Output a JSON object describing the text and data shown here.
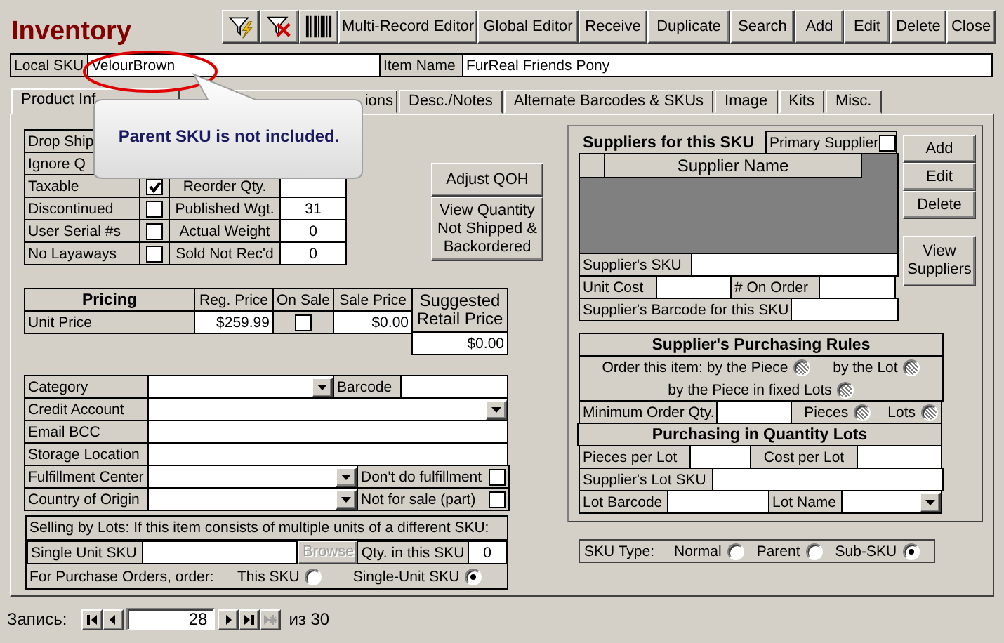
{
  "title": "Inventory",
  "toolbar": [
    {
      "kind": "filter"
    },
    {
      "kind": "unfilter"
    },
    {
      "kind": "barcode"
    },
    {
      "kind": "text",
      "label": "Multi-Record Editor"
    },
    {
      "kind": "text",
      "label": "Global Editor"
    },
    {
      "kind": "text",
      "label": "Receive"
    },
    {
      "kind": "text",
      "label": "Duplicate"
    },
    {
      "kind": "text",
      "label": "Search"
    },
    {
      "kind": "text",
      "label": "Add"
    },
    {
      "kind": "text",
      "label": "Edit"
    },
    {
      "kind": "text",
      "label": "Delete"
    },
    {
      "kind": "text",
      "label": "Close"
    }
  ],
  "sku_bar": {
    "local_sku_label": "Local SKU",
    "local_sku": "VelourBrown",
    "item_name_label": "Item Name",
    "item_name": "FurReal Friends Pony"
  },
  "tabs": [
    {
      "label": "Product Inf",
      "selected": true
    },
    {
      "label": "ions",
      "selected": false
    },
    {
      "label": "Desc./Notes",
      "selected": false
    },
    {
      "label": "Alternate Barcodes & SKUs",
      "selected": false
    },
    {
      "label": "Image",
      "selected": false
    },
    {
      "label": "Kits",
      "selected": false
    },
    {
      "label": "Misc.",
      "selected": false
    }
  ],
  "callout": {
    "text": "Parent SKU is not included."
  },
  "flags": [
    {
      "label": "Drop Ship"
    },
    {
      "label": "Ignore Q"
    },
    {
      "label": "Taxable",
      "checked": true,
      "field_label": "Reorder Qty."
    },
    {
      "label": "Discontinued",
      "checked": false,
      "field_label": "Published Wgt.",
      "field_value": "31"
    },
    {
      "label": "User Serial #s",
      "checked": false,
      "field_label": "Actual Weight",
      "field_value": "0"
    },
    {
      "label": "No Layaways",
      "checked": false,
      "field_label": "Sold Not Rec'd",
      "field_value": "0"
    }
  ],
  "side_buttons": [
    "Adjust QOH",
    "View Quantity Not Shipped & Backordered"
  ],
  "pricing": {
    "header": "Pricing",
    "reg_label": "Reg. Price",
    "on_sale_label": "On Sale",
    "sale_label": "Sale Price",
    "suggested_label": "Suggested Retail Price",
    "row_label": "Unit Price",
    "reg_price": "$259.99",
    "on_sale": false,
    "sale_price": "$0.00",
    "suggested": "$0.00"
  },
  "details": [
    {
      "kind": "combo_pair",
      "label": "Category",
      "label2": "Barcode"
    },
    {
      "kind": "combo",
      "label": "Credit Account"
    },
    {
      "kind": "text",
      "label": "Email BCC"
    },
    {
      "kind": "text",
      "label": "Storage Location"
    },
    {
      "kind": "combo_check",
      "label": "Fulfillment Center",
      "check_label": "Don't do fulfillment",
      "checked": false
    },
    {
      "kind": "combo_check",
      "label": "Country of Origin",
      "check_label": "Not for sale (part)",
      "checked": false
    }
  ],
  "lots": {
    "heading": "Selling by Lots: If this item consists of multiple units of a different SKU:",
    "single_unit_label": "Single Unit SKU",
    "browse": "Browse",
    "browse_disabled": true,
    "qty_label": "Qty. in this SKU",
    "qty": "0",
    "order_label": "For Purchase Orders, order:",
    "options": [
      {
        "label": "This SKU",
        "selected": false
      },
      {
        "label": "Single-Unit SKU",
        "selected": true
      }
    ]
  },
  "suppliers": {
    "title": "Suppliers for this SKU",
    "primary_label": "Primary Supplier",
    "primary": false,
    "column": "Supplier Name",
    "sku_label": "Supplier's SKU",
    "unit_cost_label": "Unit Cost",
    "on_order_label": "# On Order",
    "barcode_label": "Supplier's Barcode for this SKU",
    "buttons": [
      "Add",
      "Edit",
      "Delete"
    ],
    "view_button": "View Suppliers"
  },
  "rules": {
    "title": "Supplier's Purchasing Rules",
    "order_label": "Order this item:",
    "order_options": [
      {
        "label": "by the Piece",
        "indeterminate": true
      },
      {
        "label": "by the Lot",
        "indeterminate": true
      },
      {
        "label": "by the Piece in fixed Lots",
        "indeterminate": true
      }
    ],
    "min_label": "Minimum Order Qty.",
    "unit_options": [
      {
        "label": "Pieces",
        "indeterminate": true
      },
      {
        "label": "Lots",
        "indeterminate": true
      }
    ],
    "lots_title": "Purchasing in Quantity Lots",
    "pieces_label": "Pieces per Lot",
    "cost_label": "Cost per Lot",
    "lot_sku_label": "Supplier's Lot SKU",
    "lot_barcode_label": "Lot Barcode",
    "lot_name_label": "Lot Name"
  },
  "sku_type": {
    "label": "SKU Type:",
    "options": [
      {
        "label": "Normal",
        "selected": false
      },
      {
        "label": "Parent",
        "selected": false
      },
      {
        "label": "Sub-SKU",
        "selected": true
      }
    ]
  },
  "nav": {
    "label": "Запись:",
    "current": "28",
    "total": "из 30"
  }
}
